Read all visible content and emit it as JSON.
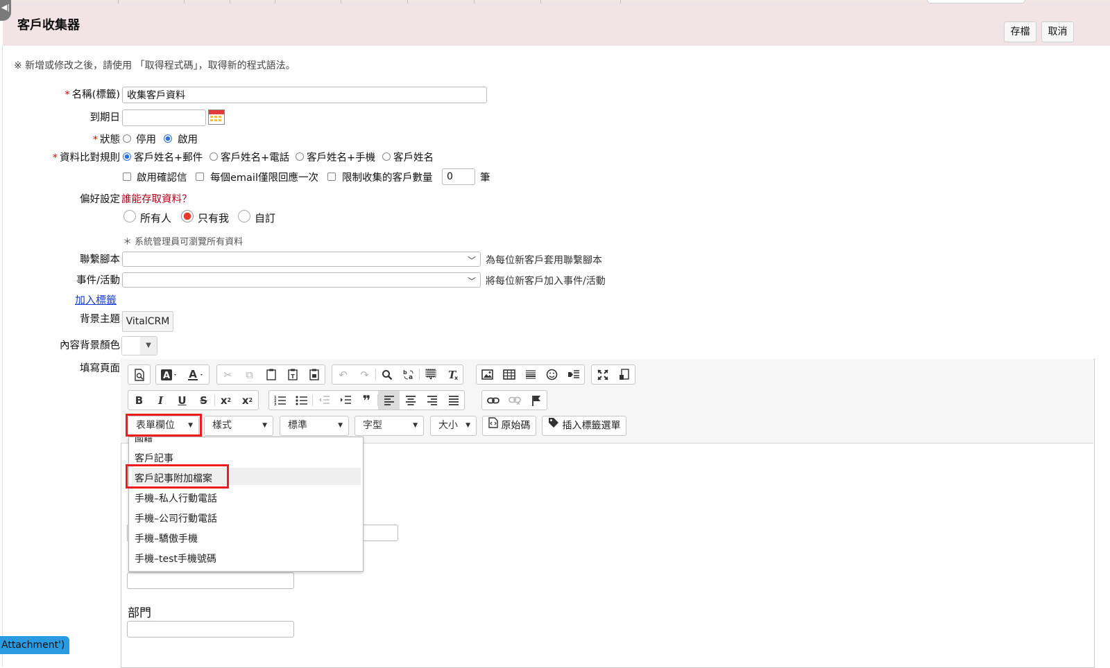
{
  "header": {
    "title": "客戶收集器",
    "save_label": "存檔",
    "cancel_label": "取消"
  },
  "notice": "※ 新增或修改之後，請使用 「取得程式碼」，取得新的程式語法。",
  "form": {
    "name_label": "名稱(標籤)",
    "name_value": "收集客戶資料",
    "expiry_label": "到期日",
    "expiry_value": "",
    "status_label": "狀態",
    "status_options": [
      "停用",
      "啟用"
    ],
    "status_selected": "啟用",
    "match_label": "資料比對規則",
    "match_options": [
      "客戶姓名+郵件",
      "客戶姓名+電話",
      "客戶姓名+手機",
      "客戶姓名"
    ],
    "match_selected": "客戶姓名+郵件",
    "check_confirm": "啟用確認信",
    "check_once": "每個email僅限回應一次",
    "check_limit": "限制收集的客戶數量",
    "limit_value": "0",
    "limit_unit": "筆",
    "pref_label": "偏好設定",
    "pref_access_link": "誰能存取資料？",
    "access_options": [
      "所有人",
      "只有我",
      "自訂"
    ],
    "access_selected": "只有我",
    "admin_note": "＊ 系統管理員可瀏覽所有資料",
    "script_label": "聯繫腳本",
    "script_hint": "為每位新客戶套用聯繫腳本",
    "event_label": "事件/活動",
    "event_hint": "將每位新客戶加入事件/活動",
    "add_tag_link": "加入標籤",
    "theme_label": "背景主題",
    "theme_value": "VitalCRM",
    "bgcolor_label": "內容背景顏色",
    "page_label": "填寫頁面"
  },
  "editor": {
    "combos": {
      "form_field": "表單欄位",
      "style": "樣式",
      "format": "標準",
      "font": "字型",
      "size": "大小"
    },
    "source_label": "原始碼",
    "insert_tag_label": "插入標籤選單",
    "dropdown_partial": "國籍",
    "dropdown_items": [
      "客戶記事",
      "客戶記事附加檔案",
      "手機–私人行動電話",
      "手機–公司行動電話",
      "手機–驕傲手機",
      "手機–test手機號碼"
    ],
    "dropdown_highlighted": "客戶記事附加檔案",
    "content_dept_label": "部門"
  },
  "tooltip": "Attachment')",
  "colors": {
    "header_bg": "#f2e4e6",
    "required": "#e00000",
    "link_dark_red": "#b3001b",
    "link_blue": "#1a3fd6",
    "highlight_box": "#ee1c1c",
    "radio_selected": "#e8392b",
    "tooltip_bg": "#2a9be0"
  }
}
